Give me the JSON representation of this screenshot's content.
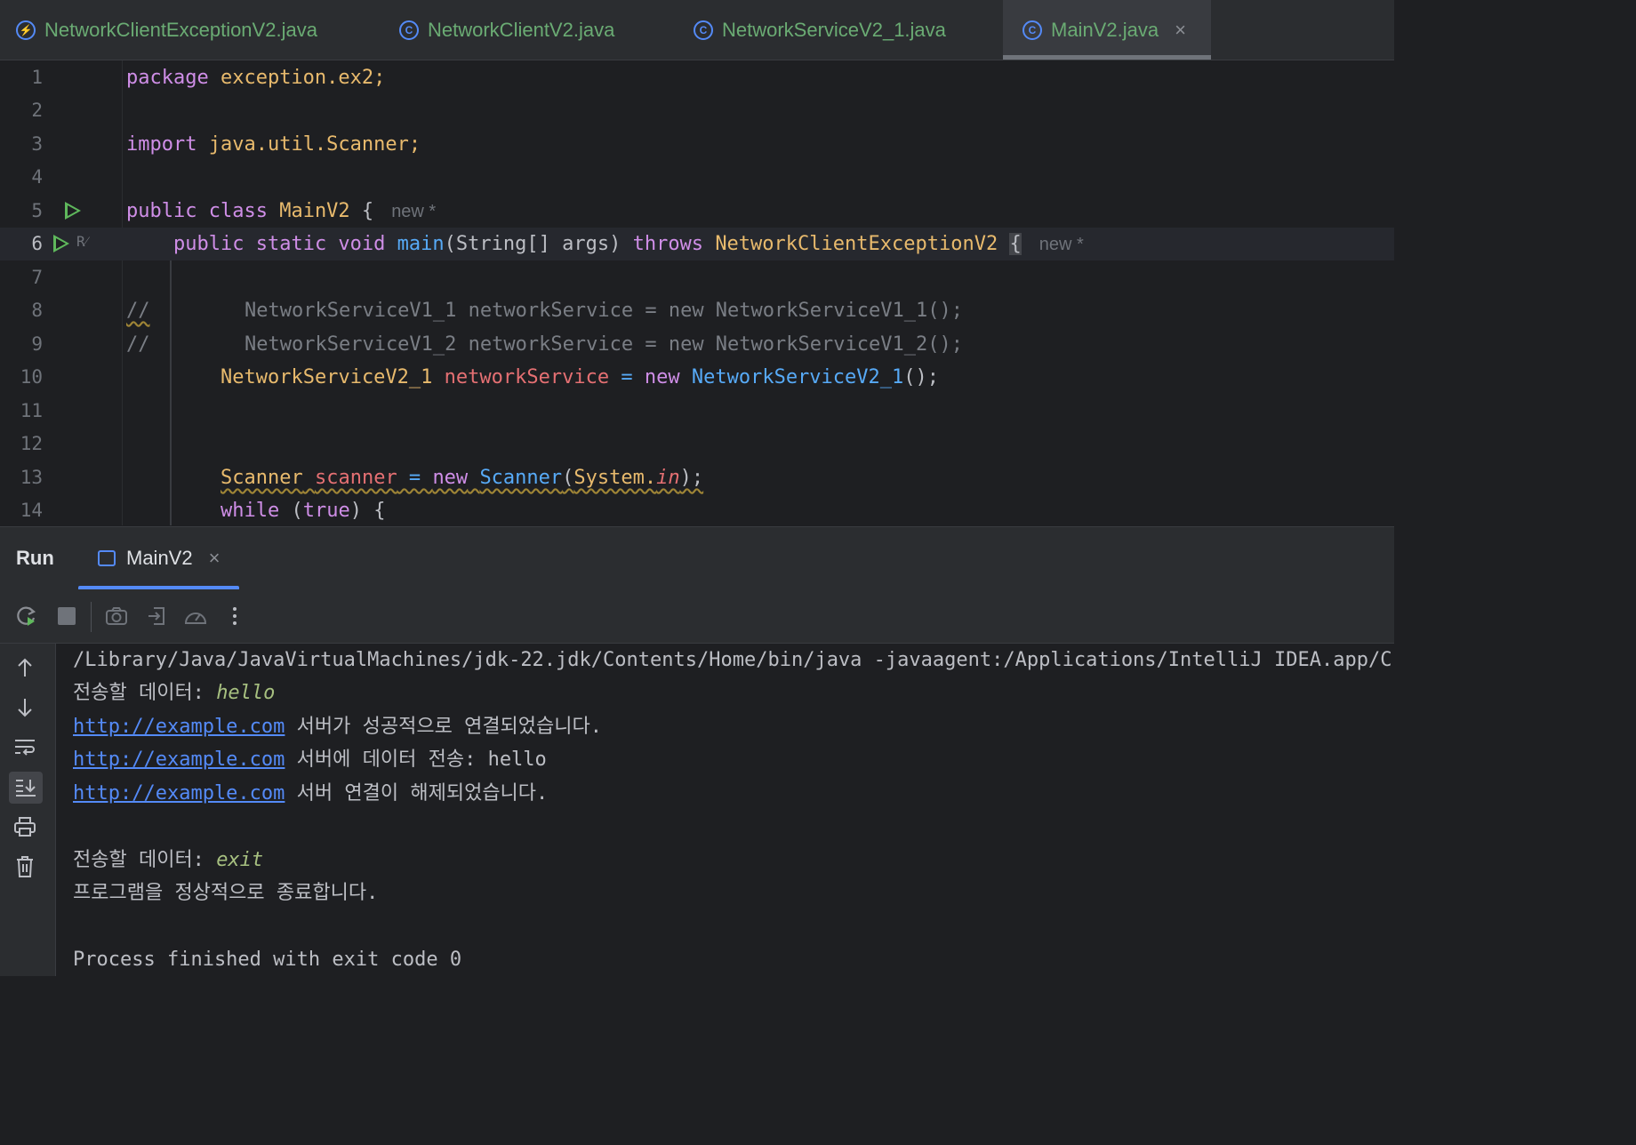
{
  "tabs": [
    {
      "label": "NetworkClientExceptionV2.java",
      "icon": "exception-class-icon",
      "glyph": "⚡"
    },
    {
      "label": "NetworkClientV2.java",
      "icon": "class-icon",
      "glyph": "C"
    },
    {
      "label": "NetworkServiceV2_1.java",
      "icon": "class-icon",
      "glyph": "C"
    },
    {
      "label": "MainV2.java",
      "icon": "runnable-class-icon",
      "glyph": "C",
      "active": true,
      "close": "×"
    }
  ],
  "editor": {
    "line_numbers": [
      "1",
      "2",
      "3",
      "4",
      "5",
      "6",
      "7",
      "8",
      "9",
      "10",
      "11",
      "12",
      "13",
      "14"
    ],
    "l1": {
      "kw": "package",
      "rest": " exception.ex2;"
    },
    "l3": {
      "kw": "import",
      "rest": " java.util.Scanner;"
    },
    "l5": {
      "kw": "public class",
      "name": "MainV2",
      "brace": " {",
      "hint": "new *"
    },
    "l6": {
      "kw1": "public static void",
      "fn": "main",
      "args": "(String[] args) ",
      "throws": "throws",
      "exc": "NetworkClientExceptionV2",
      "brace": "{",
      "hint": "new *"
    },
    "l8": {
      "marker": "//",
      "text": "NetworkServiceV1_1 networkService = new NetworkServiceV1_1();"
    },
    "l9": {
      "marker": "//",
      "text": "NetworkServiceV1_2 networkService = new NetworkServiceV1_2();"
    },
    "l10": {
      "type": "NetworkServiceV2_1",
      "var": "networkService",
      "eq": " = ",
      "new": "new",
      "ctor": "NetworkServiceV2_1",
      "end": "();"
    },
    "l13": {
      "type": "Scanner",
      "var": "scanner",
      "eq": " = ",
      "new": "new",
      "ctor": "Scanner",
      "open": "(",
      "sys": "System.",
      "field": "in",
      "end": ");"
    },
    "l14": {
      "kw": "while",
      "open": " (",
      "val": "true",
      "end": ") {"
    }
  },
  "run": {
    "title": "Run",
    "tab_label": "MainV2",
    "tab_close": "×",
    "toolbar": [
      "rerun-icon",
      "stop-icon",
      "camera-icon",
      "exit-icon",
      "gauge-icon",
      "more-icon"
    ],
    "side": [
      "arrow-up-icon",
      "arrow-down-icon",
      "soft-wrap-icon",
      "scroll-to-end-icon",
      "print-icon",
      "trash-icon"
    ]
  },
  "console": {
    "cmd": "/Library/Java/JavaVirtualMachines/jdk-22.jdk/Contents/Home/bin/java -javaagent:/Applications/IntelliJ IDEA.app/C",
    "prompt1": "전송할 데이터: ",
    "input1": "hello",
    "url": "http://example.com",
    "msg_connect": " 서버가 성공적으로 연결되었습니다.",
    "msg_send": " 서버에 데이터 전송: hello",
    "msg_disconnect": " 서버 연결이 해제되었습니다.",
    "prompt2": "전송할 데이터: ",
    "input2": "exit",
    "exit_msg": "프로그램을 정상적으로 종료합니다.",
    "finished": "Process finished with exit code 0"
  }
}
